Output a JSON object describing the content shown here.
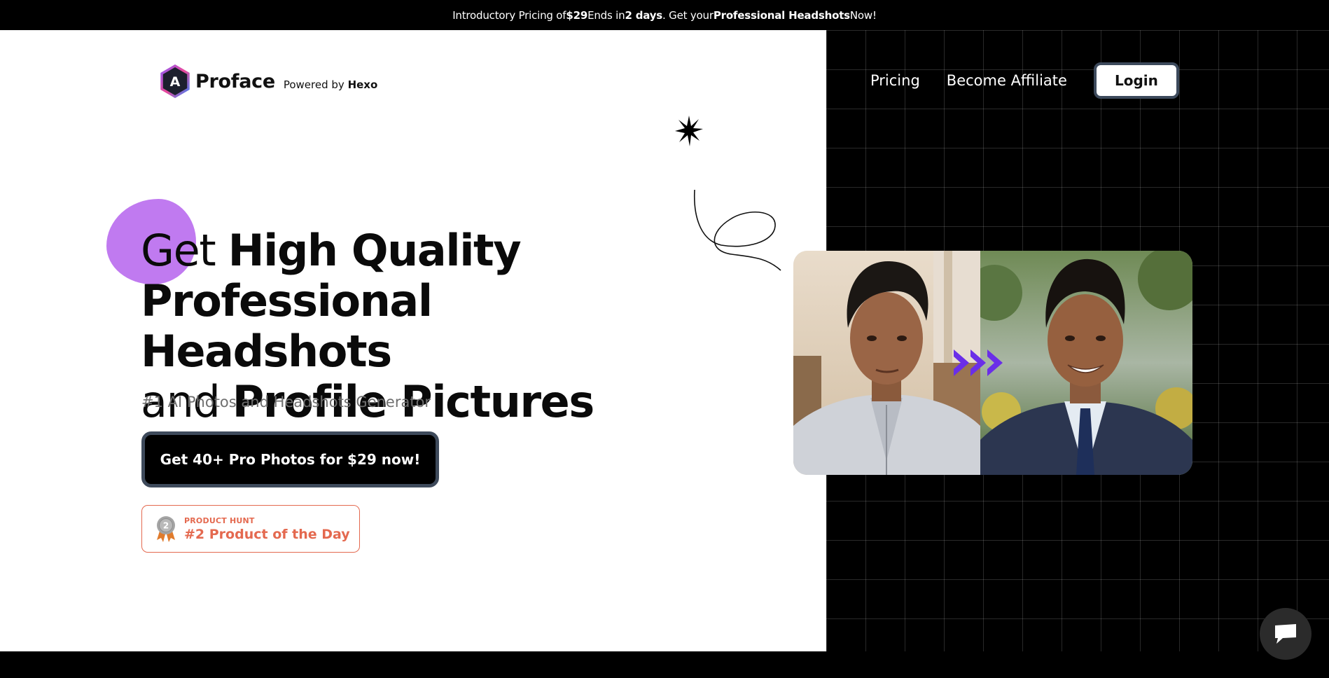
{
  "promo": {
    "prefix": "Introductory Pricing of ",
    "price": "$29",
    "middle": " Ends in ",
    "days": "2 days",
    "middle2": ". Get your ",
    "product": "Professional Headshots",
    "suffix": " Now!"
  },
  "brand": {
    "name": "Proface",
    "logo_letter": "A",
    "powered_prefix": "Powered by ",
    "powered_name": "Hexo"
  },
  "nav": {
    "pricing": "Pricing",
    "affiliate": "Become Affiliate",
    "login": "Login"
  },
  "hero": {
    "line1_light": "Get ",
    "line1_bold": "High Quality",
    "line2_bold": "Professional Headshots",
    "line3_light": "and ",
    "line3_bold": "Profile Pictures",
    "subtitle": "#1 AI Photos and Headshots Generator",
    "cta": "Get 40+ Pro Photos for $29 now!"
  },
  "badge": {
    "label_small": "PRODUCT HUNT",
    "label_big": "#2 Product of the Day",
    "medal_number": "2"
  },
  "colors": {
    "accent_purple": "#c07af0",
    "arrow_purple": "#6a2ee8",
    "badge_orange": "#e4694f",
    "cta_border": "#3e4a5b"
  }
}
